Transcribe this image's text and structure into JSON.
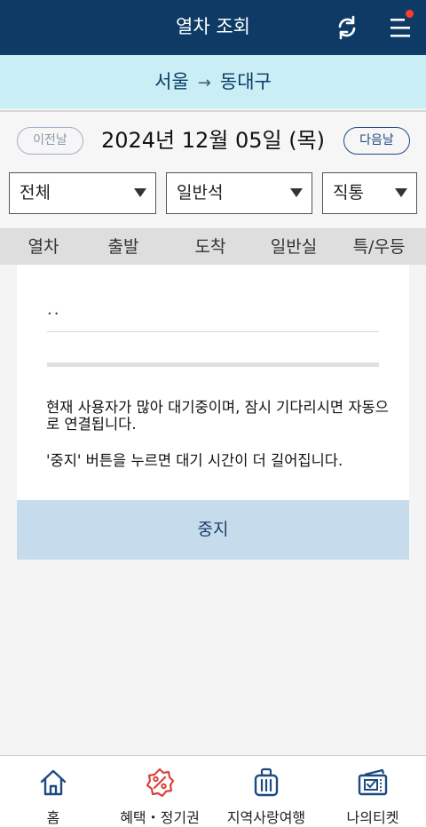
{
  "header": {
    "title": "열차 조회",
    "refresh_icon": "refresh-icon",
    "menu_icon": "menu-icon",
    "notification_dot_color": "#ff3b30"
  },
  "route": {
    "from": "서울",
    "arrow": "→",
    "to": "동대구"
  },
  "date_bar": {
    "prev_label": "이전날",
    "date": "2024년 12월 05일 (목)",
    "next_label": "다음날"
  },
  "filters": {
    "train_type": "전체",
    "seat_class": "일반석",
    "route_type": "직통"
  },
  "columns": [
    "열차",
    "출발",
    "도착",
    "일반실",
    "특/우등"
  ],
  "waiting": {
    "dots": "..",
    "message1": "현재 사용자가 많아 대기중이며, 잠시 기다리시면 자동으로 연결됩니다.",
    "message2": "'중지' 버튼을 누르면 대기 시간이 더 길어집니다.",
    "stop_label": "중지"
  },
  "bottom_nav": [
    {
      "label": "홈",
      "icon": "home-icon"
    },
    {
      "label": "혜택・정기권",
      "icon": "discount-badge-icon"
    },
    {
      "label": "지역사랑여행",
      "icon": "suitcase-icon"
    },
    {
      "label": "나의티켓",
      "icon": "ticket-icon"
    }
  ],
  "colors": {
    "header_bg": "#0d3b66",
    "route_bg": "#c9eef6",
    "stop_button_bg": "#c6dced",
    "accent_red": "#d9433a"
  }
}
